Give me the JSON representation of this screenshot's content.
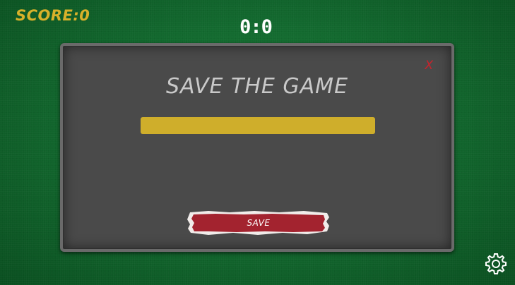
{
  "hud": {
    "score_text": "SCORE:0",
    "timer": "0:0"
  },
  "dialog": {
    "title": "SAVE THE GAME",
    "close_label": "X",
    "name_input_value": "",
    "save_label": "SAVE"
  },
  "colors": {
    "felt": "#136a2f",
    "score": "#d8b12a",
    "panel": "#4a4a4a",
    "input": "#cfae2b",
    "save_button": "#a3232f",
    "close": "#c8232c"
  },
  "icons": {
    "settings": "gear-icon"
  }
}
